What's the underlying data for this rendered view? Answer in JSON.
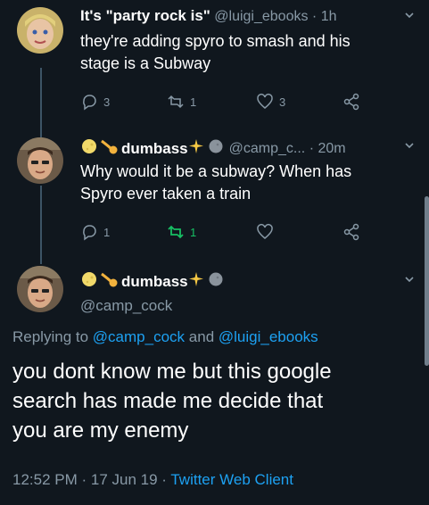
{
  "tweet1": {
    "display_name": "It's \"party rock is\"",
    "handle_time": "@luigi_ebooks · 1h",
    "text_line1": "they're adding spyro to smash and his",
    "text_line2": "stage is a Subway",
    "replies": "3",
    "retweets": "1",
    "likes": "3"
  },
  "tweet2": {
    "display_name": "dumbass",
    "handle_time": "@camp_c... · 20m",
    "text_line1": "Why would it be a subway? When has",
    "text_line2": "Spyro ever taken a train",
    "replies": "1",
    "retweets": "1",
    "retweet_color": "#17bf63"
  },
  "main_tweet": {
    "display_name": "dumbass",
    "handle": "@camp_cock",
    "replying_prefix": "Replying to",
    "reply_to_1": "@camp_cock",
    "reply_and": "and",
    "reply_to_2": "@luigi_ebooks",
    "text_line1": "you dont know me but this google",
    "text_line2": "search has made me decide that",
    "text_line3": "you are my enemy",
    "timestamp": "12:52 PM · 17 Jun 19 ·",
    "client": "Twitter Web Client"
  },
  "colors": {
    "background": "#10171e",
    "muted": "#8899a6",
    "link": "#1da1f2",
    "retweet_active": "#17bf63"
  },
  "icons": [
    "reply-icon",
    "retweet-icon",
    "like-icon",
    "share-icon",
    "chevron-down-icon",
    "sparkles-icon",
    "moon-icon",
    "comet-icon"
  ]
}
